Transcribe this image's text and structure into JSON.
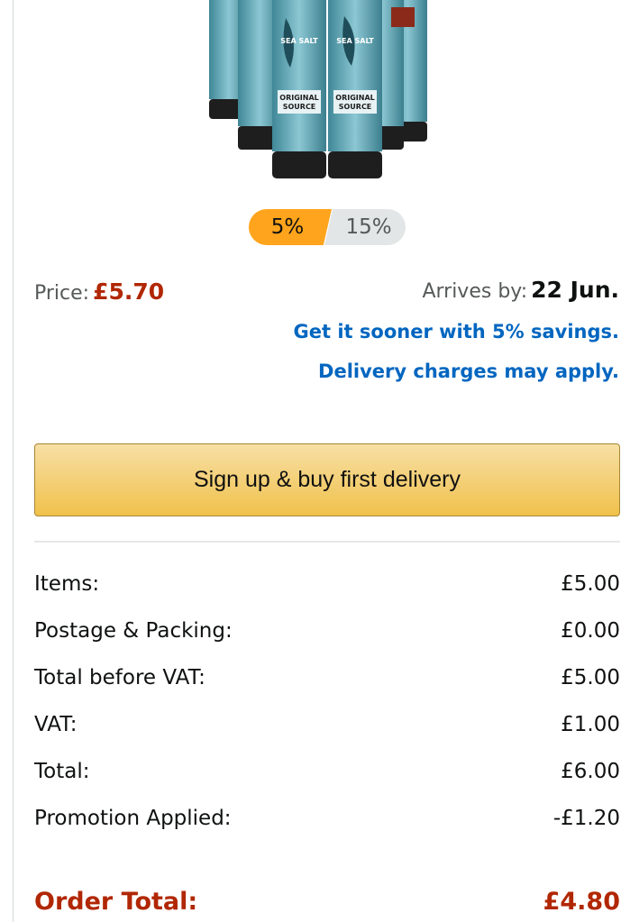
{
  "product": {
    "image_label": "ORIGINAL SOURCE",
    "image_sublabel": "SEA SALT"
  },
  "tiers": {
    "active": "5%",
    "inactive": "15%"
  },
  "price": {
    "label": "Price:",
    "value": "£5.70"
  },
  "delivery": {
    "label": "Arrives by:",
    "date": "22 Jun.",
    "sooner_link": "Get it sooner with 5% savings. Delivery charges may apply."
  },
  "cta": {
    "label": "Sign up & buy first delivery"
  },
  "summary": {
    "rows": [
      {
        "label": "Items:",
        "value": "£5.00"
      },
      {
        "label": "Postage & Packing:",
        "value": "£0.00"
      },
      {
        "label": "Total before VAT:",
        "value": "£5.00"
      },
      {
        "label": "VAT:",
        "value": "£1.00"
      },
      {
        "label": "Total:",
        "value": "£6.00"
      },
      {
        "label": "Promotion Applied:",
        "value": "-£1.20"
      }
    ],
    "order_total_label": "Order Total:",
    "order_total_value": "£4.80"
  },
  "colors": {
    "accent_price": "#b12704",
    "link": "#0066c0",
    "tier_active": "#ffa41c",
    "button": "#f0c14b",
    "bottle_teal": "#5fa7b8",
    "bottle_cap": "#1e1e1e"
  }
}
